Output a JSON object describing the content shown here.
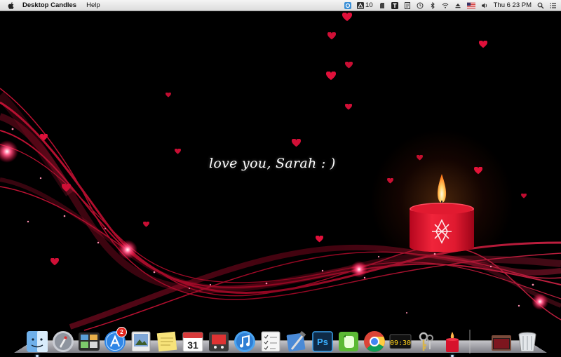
{
  "menubar": {
    "app_name": "Desktop Candles",
    "menus": [
      "Help"
    ],
    "status": {
      "adobe_count": "10",
      "datetime": "Thu 6 23 PM",
      "flag": "us-flag-icon"
    }
  },
  "desktop": {
    "message": "love you, Sarah : )",
    "accent_color": "#e0103a"
  },
  "dock": {
    "items": [
      {
        "name": "Finder",
        "icon": "finder-icon",
        "running": true
      },
      {
        "name": "Launchpad",
        "icon": "launchpad-icon"
      },
      {
        "name": "Mission Control",
        "icon": "mission-control-icon"
      },
      {
        "name": "App Store",
        "icon": "app-store-icon",
        "badge": "2"
      },
      {
        "name": "Preview",
        "icon": "preview-icon"
      },
      {
        "name": "Stickies",
        "icon": "stickies-icon"
      },
      {
        "name": "Calendar",
        "icon": "calendar-icon",
        "date": "31"
      },
      {
        "name": "Photo Booth",
        "icon": "photo-booth-icon"
      },
      {
        "name": "iTunes",
        "icon": "itunes-icon"
      },
      {
        "name": "Reminders",
        "icon": "reminders-icon"
      },
      {
        "name": "Xcode",
        "icon": "xcode-icon"
      },
      {
        "name": "Photoshop",
        "icon": "photoshop-icon",
        "label": "Ps"
      },
      {
        "name": "Evernote",
        "icon": "evernote-icon"
      },
      {
        "name": "Chrome",
        "icon": "chrome-icon"
      },
      {
        "name": "Clock",
        "icon": "clock-icon",
        "time": "09:30"
      },
      {
        "name": "Keychain Access",
        "icon": "keychain-icon"
      },
      {
        "name": "Desktop Candles",
        "icon": "candle-icon",
        "running": true
      },
      {
        "name": "Downloads",
        "icon": "downloads-folder-icon"
      },
      {
        "name": "Trash",
        "icon": "trash-icon"
      }
    ]
  }
}
